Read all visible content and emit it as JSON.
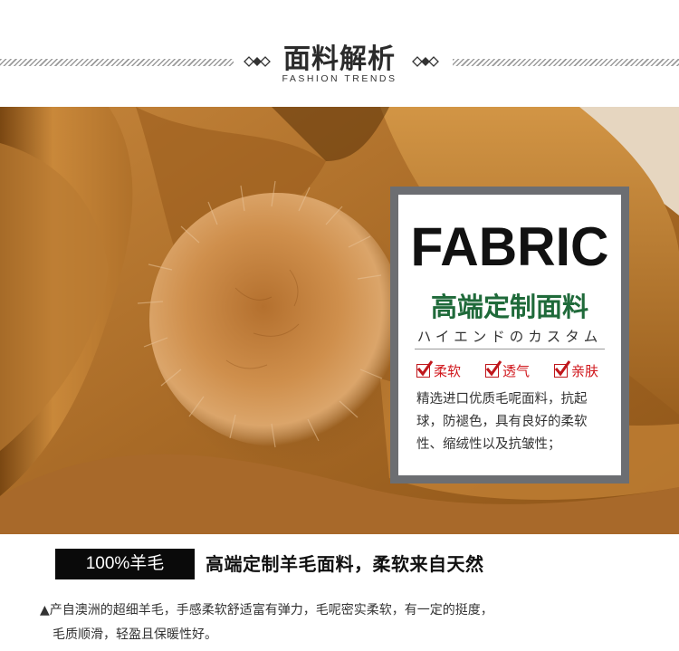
{
  "header": {
    "title": "面料解析",
    "subtitle": "FASHION TRENDS"
  },
  "card": {
    "fabric": "FABRIC",
    "heading": "高端定制面料",
    "japanese": "ハイエンドのカスタム",
    "features": [
      "柔软",
      "透气",
      "亲肤"
    ],
    "desc_lines": [
      "精选进口优质毛呢面料，抗起",
      "球，防褪色，具有良好的柔软",
      "性、缩绒性以及抗皱性；"
    ]
  },
  "bottom": {
    "badge": "100%羊毛",
    "headline": "高端定制羊毛面料，柔软来自天然",
    "desc_line1": "▲产自澳洲的超细羊毛，手感柔软舒适富有弹力，毛呢密实柔软，有一定的挺度，",
    "desc_line2": "毛质顺滑，轻盈且保暖性好。"
  },
  "colors": {
    "coat": "#b7782e",
    "fur": "#c98a45",
    "card_frame": "#6c6e72",
    "heading_green": "#1f6a3a",
    "feature_red": "#d0161b"
  }
}
